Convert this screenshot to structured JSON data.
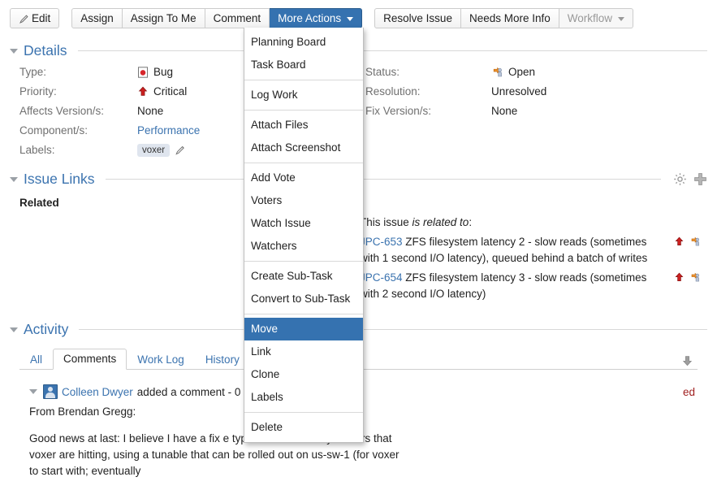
{
  "toolbar": {
    "edit_label": "Edit",
    "assign_label": "Assign",
    "assign_to_me_label": "Assign To Me",
    "comment_label": "Comment",
    "more_actions_label": "More Actions",
    "resolve_issue_label": "Resolve Issue",
    "needs_more_info_label": "Needs More Info",
    "workflow_label": "Workflow",
    "accent_color": "#3572b0"
  },
  "details": {
    "title": "Details",
    "left": [
      {
        "label": "Type:",
        "value": "Bug",
        "icon": "bug-icon"
      },
      {
        "label": "Priority:",
        "value": "Critical",
        "icon": "priority-critical-icon"
      },
      {
        "label": "Affects Version/s:",
        "value": "None",
        "icon": ""
      },
      {
        "label": "Component/s:",
        "value": "Performance",
        "icon": "",
        "is_link": true
      },
      {
        "label": "Labels:",
        "value": "voxer",
        "icon": "",
        "is_chip": true
      }
    ],
    "right": [
      {
        "label": "Status:",
        "value": "Open",
        "icon": "status-open-icon"
      },
      {
        "label": "Resolution:",
        "value": "Unresolved",
        "icon": ""
      },
      {
        "label": "Fix Version/s:",
        "value": "None",
        "icon": ""
      }
    ]
  },
  "issue_links": {
    "title": "Issue Links",
    "related_heading": "Related",
    "intro_prefix": "This issue ",
    "intro_emphasis": "is related to",
    "intro_suffix": ":",
    "items": [
      {
        "key": "JPC-653",
        "summary": "ZFS filesystem latency 2 - slow reads (sometimes with 1 second I/O latency), queued behind a batch of writes"
      },
      {
        "key": "JPC-654",
        "summary": "ZFS filesystem latency 3 - slow reads (sometimes with 2 second I/O latency)"
      }
    ]
  },
  "activity": {
    "title": "Activity",
    "tabs": [
      {
        "label": "All",
        "active": false
      },
      {
        "label": "Comments",
        "active": true
      },
      {
        "label": "Work Log",
        "active": false
      },
      {
        "label": "History",
        "active": false
      }
    ],
    "comment": {
      "author": "Colleen Dwyer",
      "action": "added a comment - 0",
      "edited_note": "ed",
      "body_line_1": "From Brendan Gregg:",
      "body_line_2": "Good news at last: I believe I have a fix                            e types of ZFS latency outliers that voxer are hitting, using a tunable that can be rolled out on us-sw-1 (for voxer to start with; eventually"
    }
  },
  "more_actions_menu": {
    "groups": [
      {
        "items": [
          {
            "label": "Planning Board",
            "highlight": false
          },
          {
            "label": "Task Board",
            "highlight": false
          }
        ]
      },
      {
        "items": [
          {
            "label": "Log Work",
            "highlight": false
          }
        ]
      },
      {
        "items": [
          {
            "label": "Attach Files",
            "highlight": false
          },
          {
            "label": "Attach Screenshot",
            "highlight": false
          }
        ]
      },
      {
        "items": [
          {
            "label": "Add Vote",
            "highlight": false
          },
          {
            "label": "Voters",
            "highlight": false
          },
          {
            "label": "Watch Issue",
            "highlight": false
          },
          {
            "label": "Watchers",
            "highlight": false
          }
        ]
      },
      {
        "items": [
          {
            "label": "Create Sub-Task",
            "highlight": false
          },
          {
            "label": "Convert to Sub-Task",
            "highlight": false
          }
        ]
      },
      {
        "items": [
          {
            "label": "Move",
            "highlight": true
          },
          {
            "label": "Link",
            "highlight": false
          },
          {
            "label": "Clone",
            "highlight": false
          },
          {
            "label": "Labels",
            "highlight": false
          }
        ]
      },
      {
        "items": [
          {
            "label": "Delete",
            "highlight": false
          }
        ]
      }
    ]
  }
}
